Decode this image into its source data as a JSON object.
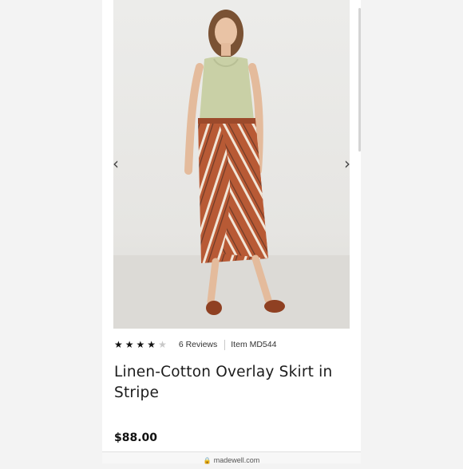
{
  "product": {
    "rating_stars_filled": 4,
    "rating_stars_total": 5,
    "reviews_label": "6 Reviews",
    "item_label": "Item MD544",
    "title": "Linen-Cotton Overlay Skirt in Stripe",
    "price": "$88.00"
  },
  "gallery": {
    "prev_icon": "chevron-left-icon",
    "next_icon": "chevron-right-icon"
  },
  "browser": {
    "url": "madewell.com",
    "lock_icon": "lock-icon"
  },
  "colors": {
    "skirt": "#b85a35",
    "stripe": "#f0e6da",
    "top": "#c9d0a6",
    "shoes": "#8f4022"
  }
}
